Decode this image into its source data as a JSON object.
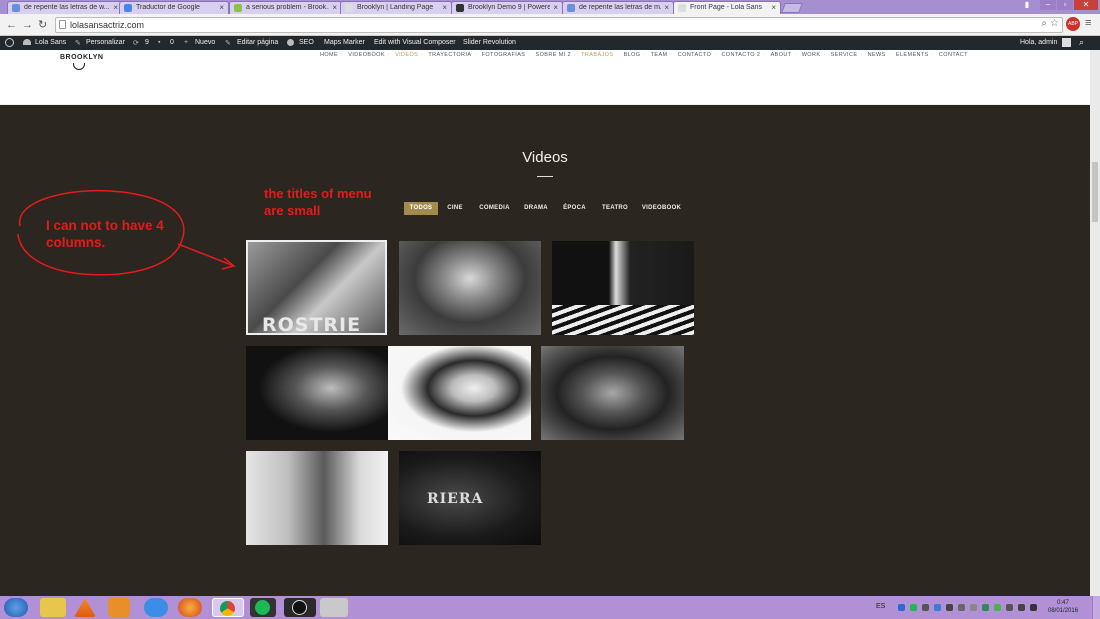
{
  "browser": {
    "tabs": [
      {
        "title": "de repente las letras de w..."
      },
      {
        "title": "Traductor de Google"
      },
      {
        "title": "a serious problem - Brook..."
      },
      {
        "title": "Brooklyn | Landing Page"
      },
      {
        "title": "Brooklyn Demo 9 | Powere..."
      },
      {
        "title": "de repente las letras de m..."
      },
      {
        "title": "Front Page - Lola Sans"
      }
    ],
    "url": "lolasansactriz.com",
    "user_badge": "ABP"
  },
  "wp_admin_bar": {
    "site_name": "Lola Sans",
    "customize": "Personalizar",
    "updates": "9",
    "comments": "0",
    "new": "Nuevo",
    "edit_page": "Editar página",
    "seo": "SEO",
    "maps_marker": "Maps Marker",
    "visual_composer": "Edit with Visual Composer",
    "slider_revolution": "Slider Revolution",
    "greeting": "Hola, admin"
  },
  "site": {
    "logo": "BROOKLYN",
    "menu": [
      "HOME",
      "VIDEOBOOK",
      "VIDEOS",
      "TRAYECTORIA",
      "FOTOGRAFÍAS",
      "SOBRE MÍ 2",
      "TRABAJOS",
      "BLOG",
      "TEAM",
      "CONTACTO",
      "CONTACTO 2",
      "ABOUT",
      "WORK",
      "SERVICE",
      "NEWS",
      "ELEMENTS",
      "CONTACT"
    ],
    "menu_active": "VIDEOS"
  },
  "videos": {
    "title": "Videos",
    "filters": [
      "TODOS",
      "CINE",
      "COMEDIA",
      "DRAMA",
      "ÉPOCA",
      "TEATRO",
      "VIDEOBOOK"
    ],
    "active_filter": "TODOS",
    "thumb_text": [
      "ROSTRIE",
      "RIERA"
    ]
  },
  "annotations": {
    "menu_note": [
      "the titles of menu",
      "are small"
    ],
    "columns_note": [
      "I can not to have 4",
      "columns."
    ]
  },
  "taskbar": {
    "lang": "ES",
    "time": "0:47",
    "date": "08/01/2016"
  },
  "colors": {
    "accent_gold": "#a38b4c",
    "dark_bg": "#2b2620",
    "annotation_red": "#e51b1b",
    "taskbar": "#b190d6"
  }
}
